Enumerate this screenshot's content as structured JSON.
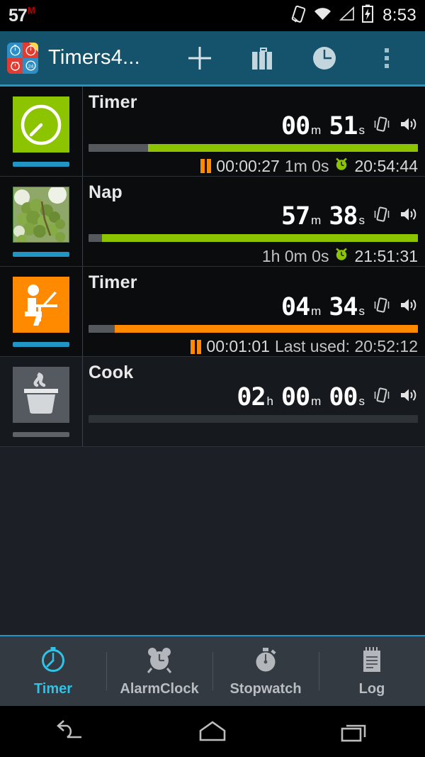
{
  "status_bar": {
    "left_number": "57",
    "left_superscript": "M",
    "clock": "8:53",
    "icons": [
      "sim-card-icon",
      "wifi-icon",
      "signal-icon",
      "battery-charging-icon"
    ]
  },
  "action_bar": {
    "app_icon": "timers4me-app-icon",
    "title": "Timers4...",
    "actions": [
      {
        "name": "add-timer-button",
        "icon": "plus-icon"
      },
      {
        "name": "presets-button",
        "icon": "briefcase-icon"
      },
      {
        "name": "clock-button",
        "icon": "clock-icon"
      },
      {
        "name": "overflow-menu-button",
        "icon": "more-vertical-icon"
      }
    ]
  },
  "colors": {
    "accent_teal": "#14536b",
    "accent_cyan": "#2196c4",
    "green": "#8dc400",
    "orange": "#ff8a00",
    "gray": "#5f6367",
    "tab_active": "#2fc3e8"
  },
  "timers": [
    {
      "name": "Timer",
      "thumbnail": "stopwatch-icon",
      "thumb_bg": "#8dc400",
      "underline_color": "#2196c4",
      "state": "running",
      "time": [
        {
          "value": "00",
          "unit": "m"
        },
        {
          "value": "51",
          "unit": "s"
        }
      ],
      "progress_elapsed_pct": 18,
      "progress_fill_pct": 82,
      "progress_color": "#8dc400",
      "meta": {
        "paused_icon": "pause-icon",
        "elapsed": "00:00:27",
        "duration": "1m 0s",
        "alarm_icon": "alarm-clock-icon",
        "alarm_time": "20:54:44"
      },
      "vibrate_icon": "vibrate-icon",
      "sound_icon": "volume-icon"
    },
    {
      "name": "Nap",
      "thumbnail": "grapes-photo",
      "thumb_bg": "#6d8f3a",
      "underline_color": "#2196c4",
      "state": "running",
      "time": [
        {
          "value": "57",
          "unit": "m"
        },
        {
          "value": "38",
          "unit": "s"
        }
      ],
      "progress_elapsed_pct": 4,
      "progress_fill_pct": 96,
      "progress_color": "#8dc400",
      "meta": {
        "paused_icon": "",
        "elapsed": "",
        "duration": "1h 0m 0s",
        "alarm_icon": "alarm-clock-icon",
        "alarm_time": "21:51:31"
      },
      "vibrate_icon": "vibrate-icon",
      "sound_icon": "volume-icon"
    },
    {
      "name": "Timer",
      "thumbnail": "person-at-desk-icon",
      "thumb_bg": "#ff8a00",
      "underline_color": "#2196c4",
      "state": "paused",
      "time": [
        {
          "value": "04",
          "unit": "m"
        },
        {
          "value": "34",
          "unit": "s"
        }
      ],
      "progress_elapsed_pct": 8,
      "progress_fill_pct": 92,
      "progress_color": "#ff8a00",
      "meta": {
        "paused_icon": "pause-icon",
        "elapsed": "00:01:01",
        "duration": "Last used: 20:52:12",
        "alarm_icon": "",
        "alarm_time": ""
      },
      "vibrate_icon": "vibrate-icon",
      "sound_icon": "volume-icon"
    },
    {
      "name": "Cook",
      "thumbnail": "cooking-pot-icon",
      "thumb_bg": "#555a60",
      "underline_color": "#5f6367",
      "state": "idle",
      "time": [
        {
          "value": "02",
          "unit": "h"
        },
        {
          "value": "00",
          "unit": "m"
        },
        {
          "value": "00",
          "unit": "s"
        }
      ],
      "progress_elapsed_pct": 0,
      "progress_fill_pct": 0,
      "progress_color": "#5f6367",
      "meta": {
        "paused_icon": "",
        "elapsed": "",
        "duration": "",
        "alarm_icon": "",
        "alarm_time": ""
      },
      "vibrate_icon": "vibrate-icon",
      "sound_icon": "volume-icon"
    }
  ],
  "tabs": [
    {
      "label": "Timer",
      "icon": "stopwatch-icon",
      "active": true
    },
    {
      "label": "AlarmClock",
      "icon": "alarm-clock-icon",
      "active": false
    },
    {
      "label": "Stopwatch",
      "icon": "stopwatch-timer-icon",
      "active": false
    },
    {
      "label": "Log",
      "icon": "notepad-icon",
      "active": false
    }
  ],
  "nav_bar": {
    "buttons": [
      {
        "name": "back-button",
        "icon": "back-arrow-icon"
      },
      {
        "name": "home-button",
        "icon": "home-icon"
      },
      {
        "name": "recents-button",
        "icon": "recents-icon"
      }
    ]
  }
}
